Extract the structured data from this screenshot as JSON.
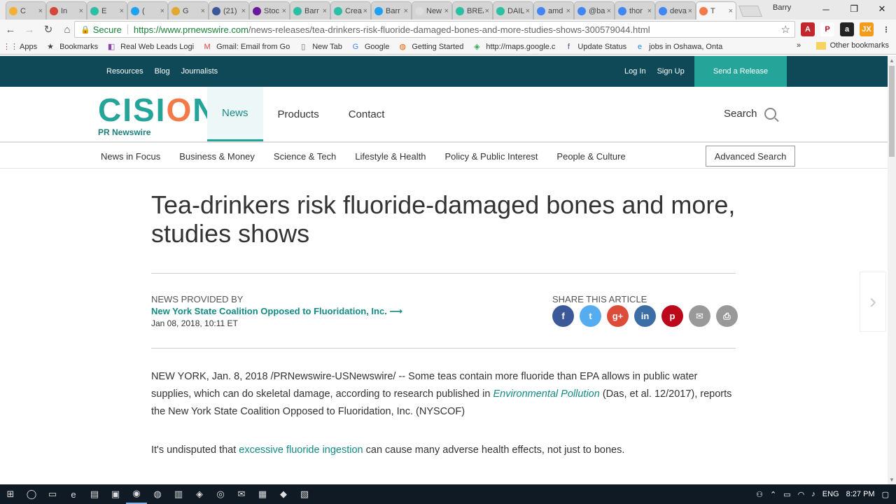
{
  "browser": {
    "tabs": [
      {
        "title": "C",
        "color": "#f2b134"
      },
      {
        "title": "In",
        "color": "#d44638"
      },
      {
        "title": "E",
        "color": "#2bbfa4"
      },
      {
        "title": "(",
        "color": "#1da1f2"
      },
      {
        "title": "G",
        "color": "#e0a82e"
      },
      {
        "title": "(21)",
        "color": "#3b5998"
      },
      {
        "title": "Stoc",
        "color": "#6a1b9a"
      },
      {
        "title": "Barr",
        "color": "#2bbfa4"
      },
      {
        "title": "Crea",
        "color": "#2bbfa4"
      },
      {
        "title": "Barr",
        "color": "#1da1f2"
      },
      {
        "title": "New Tab",
        "color": "#dddddd"
      },
      {
        "title": "BREA",
        "color": "#2bbfa4"
      },
      {
        "title": "DAIL",
        "color": "#2bbfa4"
      },
      {
        "title": "amd",
        "color": "#4285f4"
      },
      {
        "title": "@ba",
        "color": "#4285f4"
      },
      {
        "title": "thor",
        "color": "#4285f4"
      },
      {
        "title": "deva",
        "color": "#4285f4"
      },
      {
        "title": "T",
        "color": "#f37a48"
      }
    ],
    "profile_name": "Barry",
    "omnibox": {
      "secure_label": "Secure",
      "url_scheme_host": "https://www.prnewswire.com",
      "url_path": "/news-releases/tea-drinkers-risk-fluoride-damaged-bones-and-more-studies-shows-300579044.html"
    },
    "bookmarks": [
      {
        "label": "Apps",
        "icon": "apps-icon"
      },
      {
        "label": "Bookmarks",
        "icon": "star-icon"
      },
      {
        "label": "Real Web Leads Logi",
        "icon": "web-icon"
      },
      {
        "label": "Gmail: Email from Go",
        "icon": "gmail-icon"
      },
      {
        "label": "New Tab",
        "icon": "page-icon"
      },
      {
        "label": "Google",
        "icon": "google-icon"
      },
      {
        "label": "Getting Started",
        "icon": "firefox-icon"
      },
      {
        "label": "http://maps.google.c",
        "icon": "maps-icon"
      },
      {
        "label": "Update Status",
        "icon": "facebook-icon"
      },
      {
        "label": "jobs in Oshawa, Onta",
        "icon": "ie-icon"
      }
    ],
    "other_bookmarks": "Other bookmarks"
  },
  "site": {
    "topbar_left": [
      "Resources",
      "Blog",
      "Journalists"
    ],
    "topbar_right": [
      "Log In",
      "Sign Up"
    ],
    "send_release": "Send a Release",
    "logo_text_1": "CISI",
    "logo_text_o": "O",
    "logo_text_2": "N",
    "logo_sub": "PR Newswire",
    "main_nav": [
      "News",
      "Products",
      "Contact"
    ],
    "search_label": "Search",
    "sub_nav": [
      "News in Focus",
      "Business & Money",
      "Science & Tech",
      "Lifestyle & Health",
      "Policy & Public Interest",
      "People & Culture"
    ],
    "advanced_search": "Advanced Search"
  },
  "article": {
    "title": "Tea-drinkers risk fluoride-damaged bones and more, studies shows",
    "provided_by_label": "NEWS PROVIDED BY",
    "company": "New York State Coalition Opposed to Fluoridation, Inc. ⟶",
    "date": "Jan 08, 2018, 10:11 ET",
    "share_label": "SHARE THIS ARTICLE",
    "p1_a": "NEW YORK, Jan. 8, 2018 /PRNewswire-USNewswire/ -- Some teas contain more fluoride than EPA allows in public water supplies, which can do skeletal damage, according to research published in ",
    "p1_link": "Environmental Pollution",
    "p1_b": " (Das, et al. 12/2017), reports the New York State Coalition Opposed to Fluoridation, Inc. (NYSCOF)",
    "p2_a": "It's undisputed that ",
    "p2_link": "excessive fluoride ingestion",
    "p2_b": " can cause many adverse health effects, not just to bones."
  },
  "share_icons": [
    {
      "name": "facebook",
      "glyph": "f",
      "color": "#3b5998"
    },
    {
      "name": "twitter",
      "glyph": "t",
      "color": "#55acee"
    },
    {
      "name": "google-plus",
      "glyph": "g+",
      "color": "#dd4b39"
    },
    {
      "name": "linkedin",
      "glyph": "in",
      "color": "#3a6ea5"
    },
    {
      "name": "pinterest",
      "glyph": "p",
      "color": "#bd081c"
    },
    {
      "name": "email",
      "glyph": "✉",
      "color": "#999999"
    },
    {
      "name": "print",
      "glyph": "⎙",
      "color": "#999999"
    }
  ],
  "taskbar": {
    "lang": "ENG",
    "time": "8:27 PM"
  }
}
